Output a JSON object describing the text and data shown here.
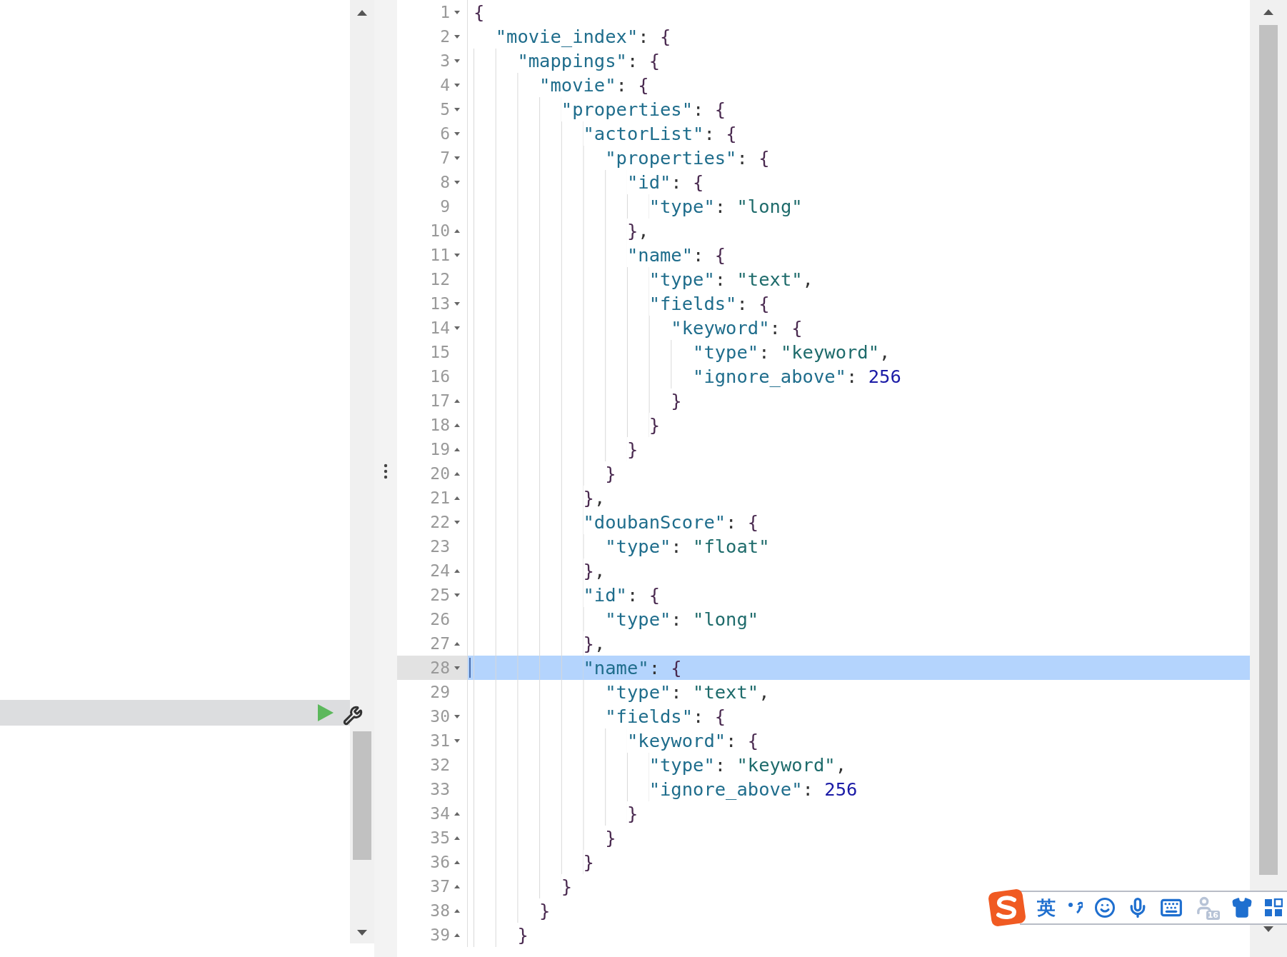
{
  "editor": {
    "lines": [
      {
        "number": "1",
        "text": "{",
        "fold_start": true,
        "selected": false
      },
      {
        "number": "2",
        "text": "  \"movie_index\": {",
        "fold_start": true,
        "selected": false
      },
      {
        "number": "3",
        "text": "    \"mappings\": {",
        "fold_start": true,
        "selected": false
      },
      {
        "number": "4",
        "text": "      \"movie\": {",
        "fold_start": true,
        "selected": false
      },
      {
        "number": "5",
        "text": "        \"properties\": {",
        "fold_start": true,
        "selected": false
      },
      {
        "number": "6",
        "text": "          \"actorList\": {",
        "fold_start": true,
        "selected": false
      },
      {
        "number": "7",
        "text": "            \"properties\": {",
        "fold_start": true,
        "selected": false
      },
      {
        "number": "8",
        "text": "              \"id\": {",
        "fold_start": true,
        "selected": false
      },
      {
        "number": "9",
        "text": "                \"type\": \"long\"",
        "selected": false
      },
      {
        "number": "10",
        "text": "              },",
        "fold_end": true,
        "selected": false
      },
      {
        "number": "11",
        "text": "              \"name\": {",
        "fold_start": true,
        "selected": false
      },
      {
        "number": "12",
        "text": "                \"type\": \"text\",",
        "selected": false
      },
      {
        "number": "13",
        "text": "                \"fields\": {",
        "fold_start": true,
        "selected": false
      },
      {
        "number": "14",
        "text": "                  \"keyword\": {",
        "fold_start": true,
        "selected": false
      },
      {
        "number": "15",
        "text": "                    \"type\": \"keyword\",",
        "selected": false
      },
      {
        "number": "16",
        "text": "                    \"ignore_above\": 256",
        "selected": false
      },
      {
        "number": "17",
        "text": "                  }",
        "fold_end": true,
        "selected": false
      },
      {
        "number": "18",
        "text": "                }",
        "fold_end": true,
        "selected": false
      },
      {
        "number": "19",
        "text": "              }",
        "fold_end": true,
        "selected": false
      },
      {
        "number": "20",
        "text": "            }",
        "fold_end": true,
        "selected": false
      },
      {
        "number": "21",
        "text": "          },",
        "fold_end": true,
        "selected": false
      },
      {
        "number": "22",
        "text": "          \"doubanScore\": {",
        "fold_start": true,
        "selected": false
      },
      {
        "number": "23",
        "text": "            \"type\": \"float\"",
        "selected": false
      },
      {
        "number": "24",
        "text": "          },",
        "fold_end": true,
        "selected": false
      },
      {
        "number": "25",
        "text": "          \"id\": {",
        "fold_start": true,
        "selected": false
      },
      {
        "number": "26",
        "text": "            \"type\": \"long\"",
        "selected": false
      },
      {
        "number": "27",
        "text": "          },",
        "fold_end": true,
        "selected": false
      },
      {
        "number": "28",
        "text": "          \"name\": {",
        "fold_start": true,
        "selected": true
      },
      {
        "number": "29",
        "text": "            \"type\": \"text\",",
        "selected": false
      },
      {
        "number": "30",
        "text": "            \"fields\": {",
        "fold_start": true,
        "selected": false
      },
      {
        "number": "31",
        "text": "              \"keyword\": {",
        "fold_start": true,
        "selected": false
      },
      {
        "number": "32",
        "text": "                \"type\": \"keyword\",",
        "selected": false
      },
      {
        "number": "33",
        "text": "                \"ignore_above\": 256",
        "selected": false
      },
      {
        "number": "34",
        "text": "              }",
        "fold_end": true,
        "selected": false
      },
      {
        "number": "35",
        "text": "            }",
        "fold_end": true,
        "selected": false
      },
      {
        "number": "36",
        "text": "          }",
        "fold_end": true,
        "selected": false
      },
      {
        "number": "37",
        "text": "        }",
        "fold_end": true,
        "selected": false
      },
      {
        "number": "38",
        "text": "      }",
        "fold_end": true,
        "selected": false
      },
      {
        "number": "39",
        "text": "    }",
        "fold_end": true,
        "selected": false
      }
    ]
  },
  "ime_toolbar": {
    "mode_label": "英",
    "user_badge": "16"
  }
}
